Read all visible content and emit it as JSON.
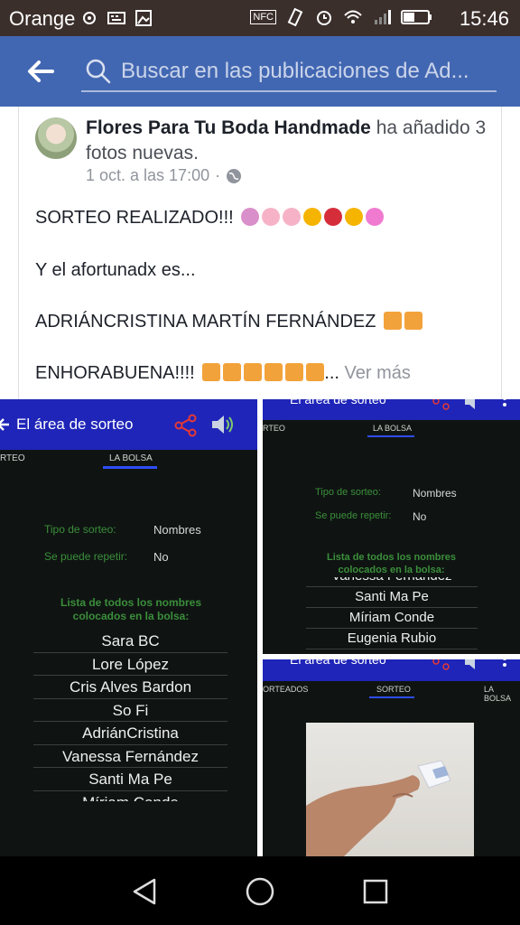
{
  "status_bar": {
    "carrier": "Orange",
    "time": "15:46",
    "nfc": "NFC"
  },
  "app_bar": {
    "search_placeholder": "Buscar en las publicaciones de Ad..."
  },
  "post": {
    "author": "Flores Para Tu Boda Handmade",
    "action": "ha añadido 3 fotos nuevas.",
    "timestamp": "1 oct. a las 17:00",
    "separator": "·",
    "lines": [
      "SORTEO REALIZADO!!!",
      "Y el afortunadx es...",
      "ADRIÁNCRISTINA MARTÍN FERNÁNDEZ",
      "ENHORABUENA!!!!"
    ],
    "ellipsis": "...",
    "see_more": "Ver más"
  },
  "photo1": {
    "title": "El área de sorteo",
    "tab_left": "RTEO",
    "tab_active": "LA BOLSA",
    "type_label": "Tipo de sorteo:",
    "type_value": "Nombres",
    "repeat_label": "Se puede repetir:",
    "repeat_value": "No",
    "list_heading_1": "Lista de todos los nombres",
    "list_heading_2": "colocados en la bolsa:",
    "names": [
      "Sara BC",
      "Lore López",
      "Cris Alves Bardon",
      "So Fi",
      "AdriánCristina",
      "Vanessa Fernández",
      "Santi Ma Pe",
      "Míriam Conde"
    ]
  },
  "photo2": {
    "title": "El área de sorteo",
    "tab_left": "RTEO",
    "tab_active": "LA BOLSA",
    "type_label": "Tipo de sorteo:",
    "type_value": "Nombres",
    "repeat_label": "Se puede repetir:",
    "repeat_value": "No",
    "list_heading_1": "Lista de todos los nombres",
    "list_heading_2": "colocados en la bolsa:",
    "names": [
      "Vanessa Fernández",
      "Santi Ma Pe",
      "Míriam Conde",
      "Eugenia Rubio"
    ]
  },
  "photo3": {
    "title": "El área de sorteo",
    "tab_left": "ORTEADOS",
    "tab_active": "SORTEO",
    "tab_right": "LA BOLSA"
  },
  "colors": {
    "facebook_blue": "#4267b2",
    "app_blue": "#1f25b8",
    "tab_indicator": "#2f4cf5",
    "label_green": "#3b8e3b"
  }
}
